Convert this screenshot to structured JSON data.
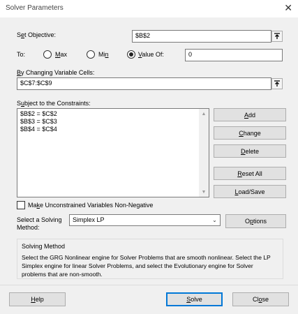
{
  "window": {
    "title": "Solver Parameters",
    "close_glyph": "✕"
  },
  "objective": {
    "label_prefix": "S",
    "label_under": "e",
    "label_rest": "t Objective:",
    "value": "$B$2"
  },
  "to": {
    "label": "To:",
    "max_prefix": "",
    "max_under": "M",
    "max_rest": "ax",
    "min_prefix": "Mi",
    "min_under": "n",
    "min_rest": "",
    "valueof_prefix": "",
    "valueof_under": "V",
    "valueof_rest": "alue Of:",
    "selected": "valueof",
    "value": "0"
  },
  "changing": {
    "label_prefix": "",
    "label_under": "B",
    "label_rest": "y Changing Variable Cells:",
    "value": "$C$7:$C$9"
  },
  "constraints": {
    "label_prefix": "S",
    "label_under": "u",
    "label_rest": "bject to the Constraints:",
    "items": [
      "$B$2 = $C$2",
      "$B$3 = $C$3",
      "$B$4 = $C$4"
    ]
  },
  "buttons": {
    "add_prefix": "",
    "add_under": "A",
    "add_rest": "dd",
    "change_prefix": "",
    "change_under": "C",
    "change_rest": "hange",
    "delete_prefix": "",
    "delete_under": "D",
    "delete_rest": "elete",
    "reset_prefix": "",
    "reset_under": "R",
    "reset_rest": "eset All",
    "load_prefix": "",
    "load_under": "L",
    "load_rest": "oad/Save",
    "options_prefix": "O",
    "options_under": "p",
    "options_rest": "tions",
    "help_prefix": "",
    "help_under": "H",
    "help_rest": "elp",
    "solve_prefix": "",
    "solve_under": "S",
    "solve_rest": "olve",
    "close_prefix": "Cl",
    "close_under": "o",
    "close_rest": "se"
  },
  "nonneg": {
    "prefix": "Ma",
    "under": "k",
    "rest": "e Unconstrained Variables Non-Negative",
    "checked": false
  },
  "method": {
    "label_line1_prefix": "Select a Solvin",
    "label_line1_under": "g",
    "label_line1_rest": "",
    "label_line2": "Method:",
    "selected": "Simplex LP"
  },
  "solving_method": {
    "title": "Solving Method",
    "description": "Select the GRG Nonlinear engine for Solver Problems that are smooth nonlinear. Select the LP Simplex engine for linear Solver Problems, and select the Evolutionary engine for Solver problems that are non-smooth."
  },
  "icons": {
    "picker": "collapse-dialog-icon",
    "scroll_up": "scroll-up-arrow-icon",
    "scroll_down": "scroll-down-arrow-icon",
    "dropdown": "chevron-down-icon"
  },
  "colors": {
    "default_button_border": "#0078d7",
    "dialog_bg": "#f0f0f0"
  }
}
